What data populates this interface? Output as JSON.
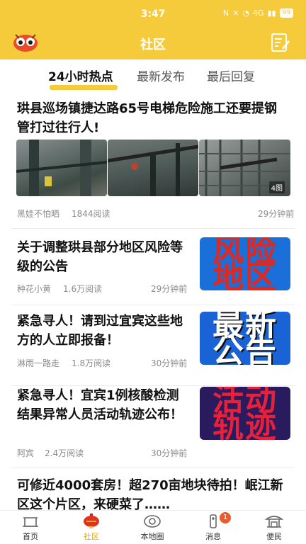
{
  "status_bar": {
    "time": "3:47",
    "network": "4G",
    "battery": "99"
  },
  "header": {
    "title": "社区"
  },
  "tabs": [
    {
      "label": "24小时热点",
      "active": true
    },
    {
      "label": "最新发布",
      "active": false
    },
    {
      "label": "最后回复",
      "active": false
    }
  ],
  "posts": [
    {
      "title": "珙县巡场镇捷达路65号电梯危险施工还要提钢管打过往行人!",
      "author": "黑娃不怕晒",
      "reads": "1844阅读",
      "time": "29分钟前",
      "image_count": "4图"
    },
    {
      "title": "关于调整珙县部分地区风险等级的公告",
      "author": "种花小黄",
      "reads": "1.6万阅读",
      "time": "29分钟前",
      "thumb_text": "风险地区"
    },
    {
      "title": "紧急寻人！请到过宜宾这些地方的人立即报备！",
      "author": "淋雨一路走",
      "reads": "1.8万阅读",
      "time": "30分钟前",
      "thumb_text": "最新公告"
    },
    {
      "title": "紧急寻人！宜宾1例核酸检测结果异常人员活动轨迹公布！",
      "author": "阿宾",
      "reads": "2.4万阅读",
      "time": "30分钟前",
      "thumb_text": "活动轨迹"
    },
    {
      "title": "可修近4000套房！超270亩地块待拍！岷江新区这个片区，来硬菜了……"
    }
  ],
  "tabbar": [
    {
      "label": "首页",
      "icon": "home-icon"
    },
    {
      "label": "社区",
      "icon": "lantern-icon",
      "active": true
    },
    {
      "label": "本地圈",
      "icon": "eye-icon"
    },
    {
      "label": "消息",
      "icon": "message-icon",
      "badge": "1"
    },
    {
      "label": "便民",
      "icon": "pavilion-icon"
    }
  ],
  "colors": {
    "brand": "#f6cb3b",
    "accent_orange": "#e5a400",
    "badge": "#f05a28"
  }
}
